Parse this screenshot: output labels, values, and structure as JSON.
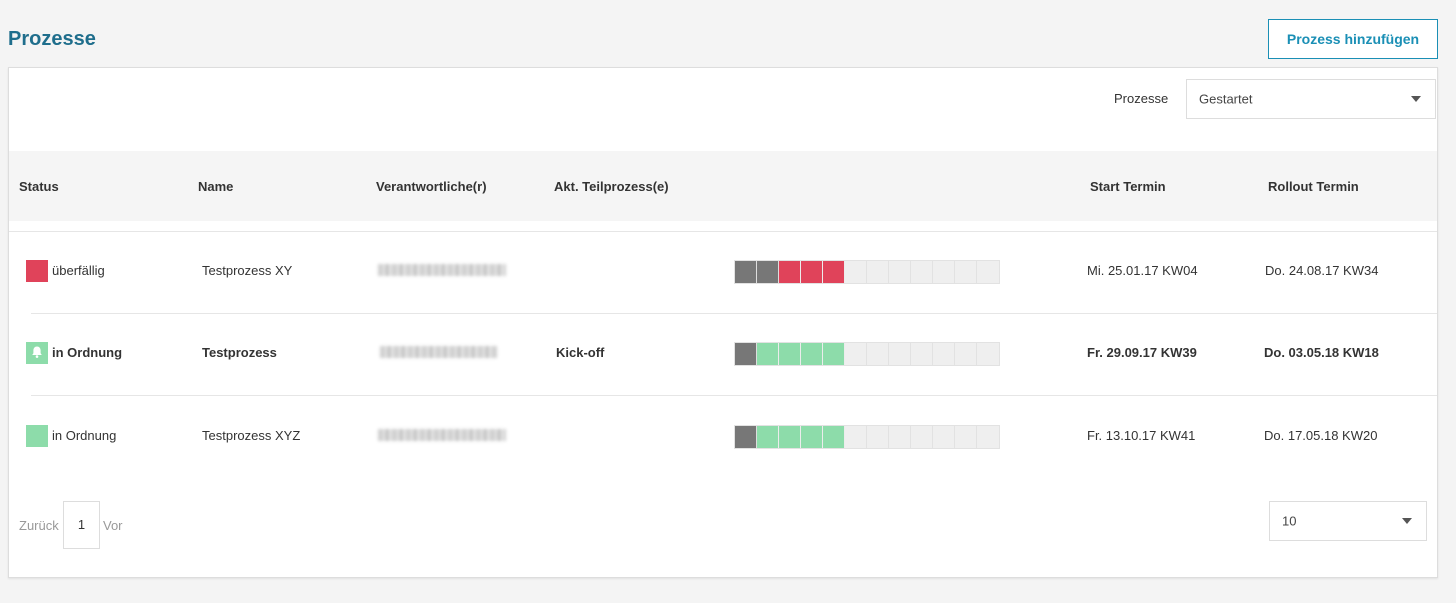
{
  "header": {
    "title": "Prozesse",
    "add_button_label": "Prozess hinzufügen"
  },
  "filter": {
    "label": "Prozesse",
    "selected": "Gestartet"
  },
  "table": {
    "columns": [
      "Status",
      "Name",
      "Verantwortliche(r)",
      "Akt. Teilprozess(e)",
      "Start Termin",
      "Rollout Termin"
    ],
    "rows": [
      {
        "status": "überfällig",
        "status_color": "#e0435a",
        "status_icon": "",
        "name": "Testprozess XY",
        "responsible": "",
        "subprocess": "",
        "progress": [
          "gray",
          "gray",
          "red",
          "red",
          "red",
          "empty",
          "empty",
          "empty",
          "empty",
          "empty",
          "empty",
          "empty"
        ],
        "start": "Mi. 25.01.17 KW04",
        "rollout": "Do. 24.08.17 KW34",
        "bold": false
      },
      {
        "status": "in Ordnung",
        "status_color": "#8ddcaa",
        "status_icon": "bell-icon",
        "name": "Testprozess",
        "responsible": "",
        "subprocess": "Kick-off",
        "progress": [
          "gray",
          "green",
          "green",
          "green",
          "green",
          "empty",
          "empty",
          "empty",
          "empty",
          "empty",
          "empty",
          "empty"
        ],
        "start": "Fr. 29.09.17 KW39",
        "rollout": "Do. 03.05.18 KW18",
        "bold": true
      },
      {
        "status": "in Ordnung",
        "status_color": "#8ddcaa",
        "status_icon": "",
        "name": "Testprozess XYZ",
        "responsible": "",
        "subprocess": "",
        "progress": [
          "gray",
          "green",
          "green",
          "green",
          "green",
          "empty",
          "empty",
          "empty",
          "empty",
          "empty",
          "empty",
          "empty"
        ],
        "start": "Fr. 13.10.17 KW41",
        "rollout": "Do. 17.05.18 KW20",
        "bold": false
      }
    ]
  },
  "pagination": {
    "prev_label": "Zurück",
    "current_page": "1",
    "next_label": "Vor",
    "page_size": "10"
  },
  "colors": {
    "title": "#1f6e8c",
    "accent": "#1a8fb5",
    "overdue": "#e0435a",
    "ok": "#8ddcaa",
    "done": "#777777"
  }
}
